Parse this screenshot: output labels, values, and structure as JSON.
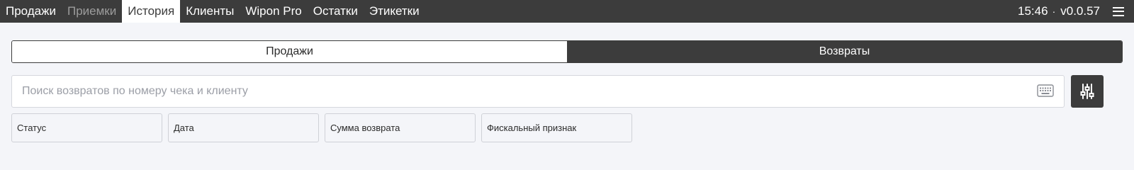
{
  "nav": {
    "items": [
      {
        "label": "Продажи"
      },
      {
        "label": "Приемки"
      },
      {
        "label": "История"
      },
      {
        "label": "Клиенты"
      },
      {
        "label": "Wipon Pro"
      },
      {
        "label": "Остатки"
      },
      {
        "label": "Этикетки"
      }
    ],
    "active_index": 2
  },
  "status": {
    "time": "15:46",
    "separator": "·",
    "version": "v0.0.57"
  },
  "segment": {
    "sales_label": "Продажи",
    "returns_label": "Возвраты",
    "selected": "Возвраты"
  },
  "search": {
    "placeholder": "Поиск возвратов по номеру чека и клиенту",
    "value": ""
  },
  "filters": [
    {
      "label": "Статус"
    },
    {
      "label": "Дата"
    },
    {
      "label": "Сумма возврата"
    },
    {
      "label": "Фискальный признак"
    }
  ],
  "icons": {
    "menu": "hamburger-icon",
    "keyboard": "keyboard-icon",
    "filter": "sliders-icon"
  },
  "colors": {
    "topbar": "#3c3c3c",
    "background": "#f4f5f9",
    "active_tab": "#ffffff",
    "dim_tab_text": "#9c9c9c"
  }
}
